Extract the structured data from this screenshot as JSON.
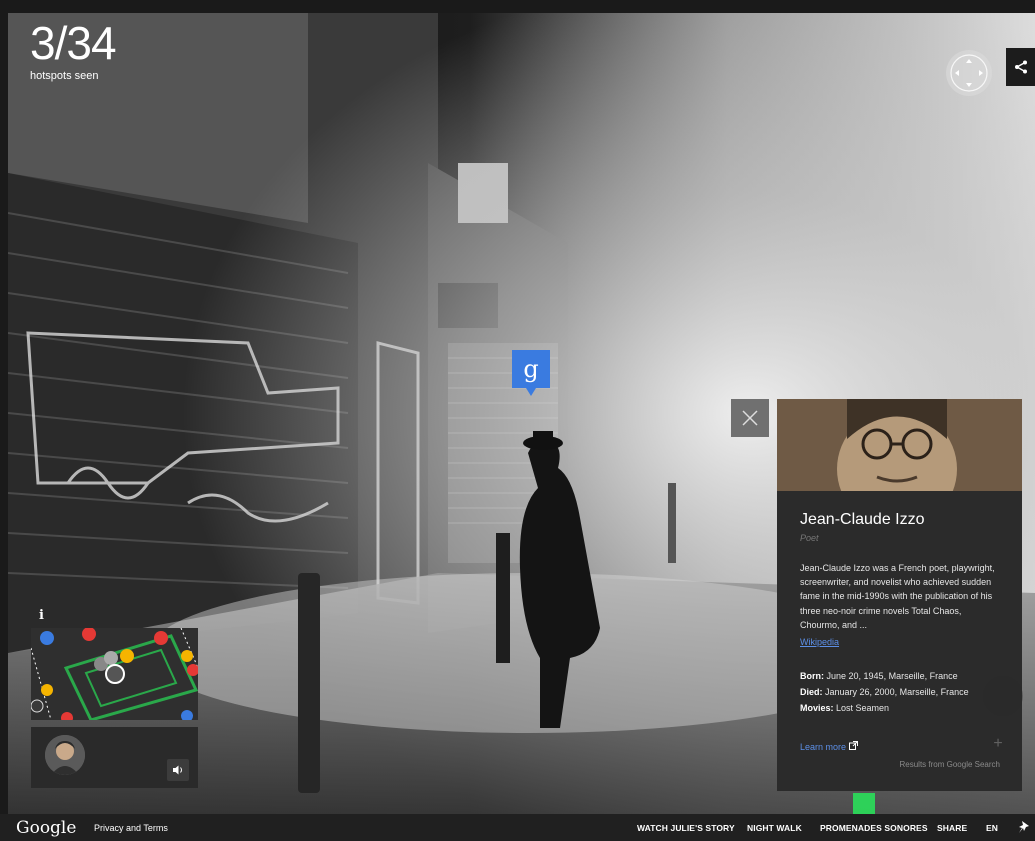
{
  "counter": {
    "current": "3",
    "total": "34",
    "label": "hotspots seen"
  },
  "marker": {
    "glyph": "g"
  },
  "card": {
    "name": "Jean-Claude Izzo",
    "role": "Poet",
    "description": "Jean-Claude Izzo was a French poet, playwright, screenwriter, and novelist who achieved sudden fame in the mid-1990s with the publication of his three neo-noir crime novels Total Chaos, Chourmo, and ...",
    "wiki_link": "Wikipedia",
    "born_label": "Born:",
    "born_value": "June 20, 1945, Marseille, France",
    "died_label": "Died:",
    "died_value": "January 26, 2000, Marseille, France",
    "movies_label": "Movies:",
    "movies_value": "Lost Seamen",
    "learn_more": "Learn more",
    "attribution": "Results from Google Search"
  },
  "minimap": {
    "info_glyph": "i"
  },
  "footer": {
    "logo": "Google",
    "privacy": "Privacy and Terms",
    "links": [
      "WATCH JULIE'S STORY",
      "NIGHT WALK",
      "PROMENADES SONORES",
      "SHARE",
      "EN"
    ]
  },
  "colors": {
    "accent_blue": "#3a7be0",
    "link_blue": "#5c8fe6",
    "map_green": "#2aa84a",
    "map_red": "#e53935",
    "map_yellow": "#f5b400"
  },
  "icons": [
    "share-icon",
    "compass-icon",
    "close-icon",
    "speaker-icon",
    "pin-icon",
    "external-link-icon"
  ]
}
